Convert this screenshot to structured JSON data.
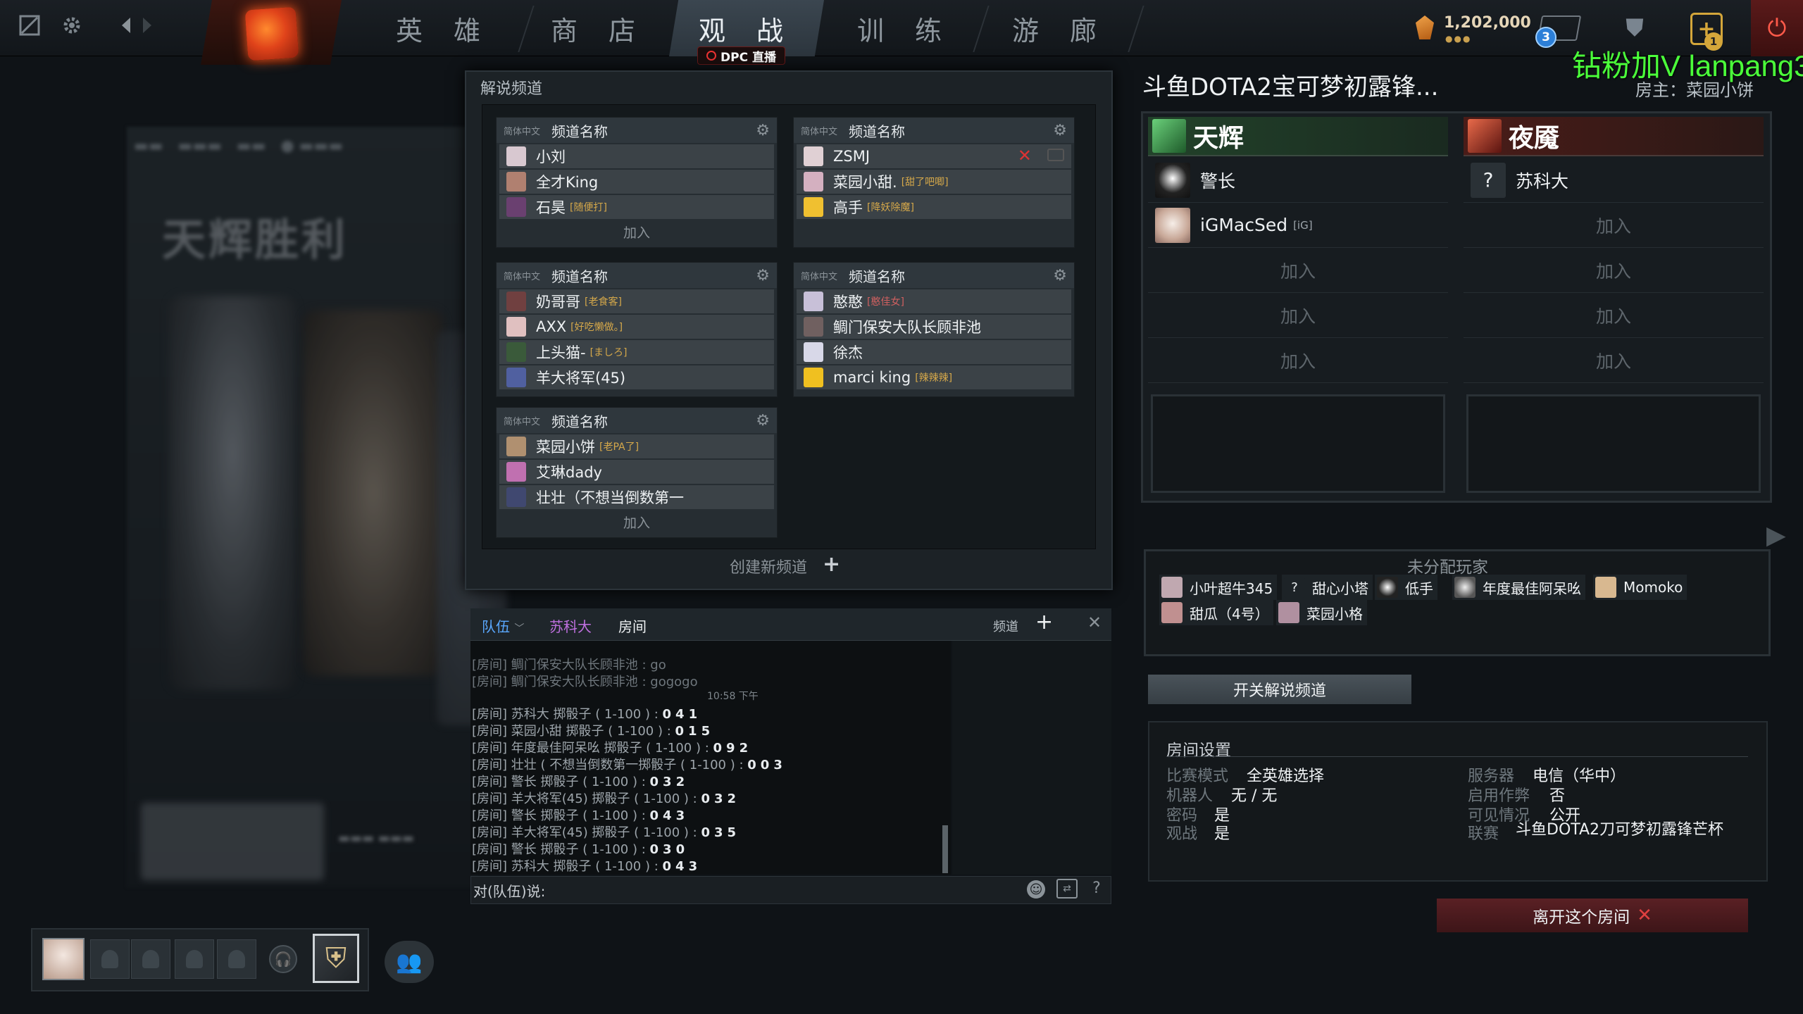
{
  "nav": {
    "tabs": [
      "英 雄",
      "商 店",
      "观 战",
      "训 练",
      "游 廊"
    ],
    "dpc_label": "DPC 直播",
    "shards": "1,202,000",
    "mail_count": "3",
    "plus_count": "1"
  },
  "watermark": "钻粉加V lanpang3",
  "background": {
    "victory": "天辉胜利"
  },
  "caster": {
    "title": "解说频道",
    "create_label": "创建新频道",
    "channels": [
      {
        "lang": "简体中文",
        "name": "频道名称",
        "join": "加入",
        "users": [
          {
            "name": "小刘",
            "tag": ""
          },
          {
            "name": "全才King",
            "tag": ""
          },
          {
            "name": "石昊",
            "tag": "[随便打]"
          }
        ]
      },
      {
        "lang": "简体中文",
        "name": "频道名称",
        "join": "",
        "users": [
          {
            "name": "ZSMJ",
            "tag": ""
          },
          {
            "name": "菜园小甜.",
            "tag": "[甜了吧唧]"
          },
          {
            "name": "高手",
            "tag": "[降妖除魔]"
          }
        ]
      },
      {
        "lang": "简体中文",
        "name": "频道名称",
        "join": "",
        "users": [
          {
            "name": "奶哥哥",
            "tag": "[老食客]"
          },
          {
            "name": "AXX",
            "tag": "[好吃懒做。]"
          },
          {
            "name": "上头猫-",
            "tag": "[ましろ]"
          },
          {
            "name": "羊大将军(45)",
            "tag": ""
          }
        ]
      },
      {
        "lang": "简体中文",
        "name": "频道名称",
        "join": "",
        "users": [
          {
            "name": "憨憨",
            "tag": "[憨佳女]"
          },
          {
            "name": "鲷门保安大队长顾非池",
            "tag": ""
          },
          {
            "name": "徐杰",
            "tag": ""
          },
          {
            "name": "marci king",
            "tag": "[辣辣辣]"
          }
        ]
      },
      {
        "lang": "简体中文",
        "name": "频道名称",
        "join": "加入",
        "users": [
          {
            "name": "菜园小饼",
            "tag": "[老PA了]"
          },
          {
            "name": "艾琳dady",
            "tag": ""
          },
          {
            "name": "壮壮（不想当倒数第一",
            "tag": ""
          }
        ]
      }
    ]
  },
  "chat": {
    "tabs": {
      "team": "队伍",
      "player": "苏科大",
      "room": "房间",
      "channel": "频道"
    },
    "time": "10:58 下午",
    "input_label": "对(队伍)说:",
    "lines": [
      {
        "text": "[房间] 鲷门保安大队长顾非池 : go",
        "roll": ""
      },
      {
        "text": "[房间] 鲷门保安大队长顾非池 : gogogo",
        "roll": ""
      },
      {
        "text": "[房间] 苏科大 掷骰子 ( 1-100 ) : ",
        "roll": "041"
      },
      {
        "text": "[房间] 菜园小甜 掷骰子 ( 1-100 ) : ",
        "roll": "015"
      },
      {
        "text": "[房间] 年度最佳阿呆吆 掷骰子 ( 1-100 ) : ",
        "roll": "092"
      },
      {
        "text": "[房间] 壮壮 ( 不想当倒数第一掷骰子 ( 1-100 ) : ",
        "roll": "003"
      },
      {
        "text": "[房间] 警长 掷骰子 ( 1-100 ) : ",
        "roll": "032"
      },
      {
        "text": "[房间] 羊大将军(45) 掷骰子 ( 1-100 ) : ",
        "roll": "032"
      },
      {
        "text": "[房间] 警长 掷骰子 ( 1-100 ) : ",
        "roll": "043"
      },
      {
        "text": "[房间] 羊大将军(45) 掷骰子 ( 1-100 ) : ",
        "roll": "035"
      },
      {
        "text": "[房间] 警长 掷骰子 ( 1-100 ) : ",
        "roll": "030"
      },
      {
        "text": "[房间] 苏科大 掷骰子 ( 1-100 ) : ",
        "roll": "043"
      }
    ]
  },
  "lobby": {
    "title": "斗鱼DOTA2宝可梦初露锋...",
    "host": "房主：菜园小饼",
    "radiant": {
      "name": "天辉",
      "slots": [
        {
          "name": "警长",
          "tag": ""
        },
        {
          "name": "iGMacSed",
          "tag": "[iG]"
        },
        {
          "name": "加入",
          "tag": ""
        },
        {
          "name": "加入",
          "tag": ""
        },
        {
          "name": "加入",
          "tag": ""
        }
      ]
    },
    "dire": {
      "name": "夜魇",
      "slots": [
        {
          "name": "苏科大",
          "tag": ""
        },
        {
          "name": "加入",
          "tag": ""
        },
        {
          "name": "加入",
          "tag": ""
        },
        {
          "name": "加入",
          "tag": ""
        },
        {
          "name": "加入",
          "tag": ""
        }
      ]
    },
    "unassigned_title": "未分配玩家",
    "unassigned": [
      "小叶超牛345",
      "甜心小塔",
      "低手",
      "年度最佳阿呆吆",
      "Momoko",
      "甜瓜（4号）",
      "菜园小格"
    ],
    "toggle_caster": "开关解说频道",
    "settings_title": "房间设置",
    "settings": {
      "mode_k": "比赛模式",
      "mode_v": "全英雄选择",
      "bots_k": "机器人",
      "bots_v": "无 / 无",
      "pw_k": "密码",
      "pw_v": "是",
      "spec_k": "观战",
      "spec_v": "是",
      "server_k": "服务器",
      "server_v": "电信（华中）",
      "cheat_k": "启用作弊",
      "cheat_v": "否",
      "vis_k": "可见情况",
      "vis_v": "公开",
      "league_k": "联赛",
      "league_v": "斗鱼DOTA2刀可梦初露锋芒杯"
    },
    "leave": "离开这个房间"
  }
}
